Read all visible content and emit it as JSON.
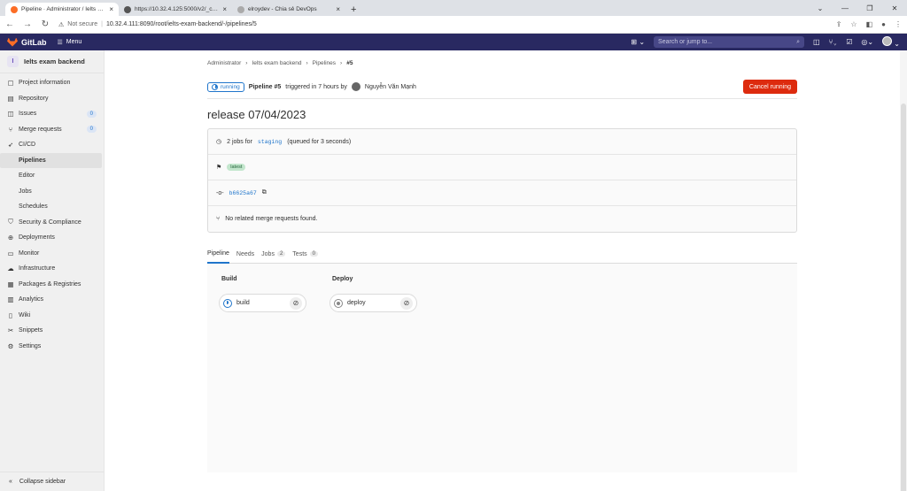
{
  "browser": {
    "tabs": [
      {
        "title": "Pipeline · Administrator / Ielts ex...",
        "active": true,
        "icon_color": "#fc6d26"
      },
      {
        "title": "https://10.32.4.125:5000/v2/_cat...",
        "active": false,
        "icon_color": "#555555"
      },
      {
        "title": "elroydev - Chia sẻ DevOps",
        "active": false,
        "icon_color": "#aaaaaa"
      }
    ],
    "new_tab": "+",
    "not_secure": "Not secure",
    "url": "10.32.4.111:8090/root/ielts-exam-backend/-/pipelines/5"
  },
  "header": {
    "brand": "GitLab",
    "menu_label": "Menu",
    "search_placeholder": "Search or jump to...",
    "colors": {
      "bg": "#292961"
    }
  },
  "sidebar": {
    "project_initial": "I",
    "project_name": "Ielts exam backend",
    "items": [
      {
        "label": "Project information",
        "icon": "info-icon",
        "glyph": "▢",
        "sub": false
      },
      {
        "label": "Repository",
        "icon": "repository-icon",
        "glyph": "▤",
        "sub": false
      },
      {
        "label": "Issues",
        "icon": "issues-icon",
        "glyph": "◫",
        "sub": false,
        "count": "0"
      },
      {
        "label": "Merge requests",
        "icon": "merge-request-icon",
        "glyph": "⑂",
        "sub": false,
        "count": "0"
      },
      {
        "label": "CI/CD",
        "icon": "rocket-icon",
        "glyph": "➶",
        "sub": false
      },
      {
        "label": "Pipelines",
        "sub": true,
        "active": true
      },
      {
        "label": "Editor",
        "sub": true
      },
      {
        "label": "Jobs",
        "sub": true
      },
      {
        "label": "Schedules",
        "sub": true
      },
      {
        "label": "Security & Compliance",
        "icon": "shield-icon",
        "glyph": "⛉",
        "sub": false
      },
      {
        "label": "Deployments",
        "icon": "deployments-icon",
        "glyph": "⊕",
        "sub": false
      },
      {
        "label": "Monitor",
        "icon": "monitor-icon",
        "glyph": "▭",
        "sub": false
      },
      {
        "label": "Infrastructure",
        "icon": "cloud-icon",
        "glyph": "☁",
        "sub": false
      },
      {
        "label": "Packages & Registries",
        "icon": "package-icon",
        "glyph": "▦",
        "sub": false
      },
      {
        "label": "Analytics",
        "icon": "chart-icon",
        "glyph": "▥",
        "sub": false
      },
      {
        "label": "Wiki",
        "icon": "book-icon",
        "glyph": "▯",
        "sub": false
      },
      {
        "label": "Snippets",
        "icon": "scissors-icon",
        "glyph": "✂",
        "sub": false
      },
      {
        "label": "Settings",
        "icon": "gear-icon",
        "glyph": "⚙",
        "sub": false
      }
    ],
    "collapse_label": "Collapse sidebar"
  },
  "breadcrumb": [
    "Administrator",
    "Ielts exam backend",
    "Pipelines",
    "#5"
  ],
  "pipeline": {
    "status": "running",
    "label": "Pipeline #5",
    "triggered": "triggered in 7 hours by",
    "user": "Nguyễn Văn Mạnh",
    "cancel_label": "Cancel running",
    "title": "release 07/04/2023",
    "jobs_prefix": "2 jobs for",
    "branch": "staging",
    "jobs_suffix": "(queued for 3 seconds)",
    "latest_badge": "latest",
    "commit": "b6625a67",
    "mr_text": "No related merge requests found."
  },
  "tabs": [
    {
      "label": "Pipeline",
      "active": true
    },
    {
      "label": "Needs"
    },
    {
      "label": "Jobs",
      "count": "2"
    },
    {
      "label": "Tests",
      "count": "0"
    }
  ],
  "stages": [
    {
      "title": "Build",
      "job": "build",
      "status": "running"
    },
    {
      "title": "Deploy",
      "job": "deploy",
      "status": "created"
    }
  ]
}
